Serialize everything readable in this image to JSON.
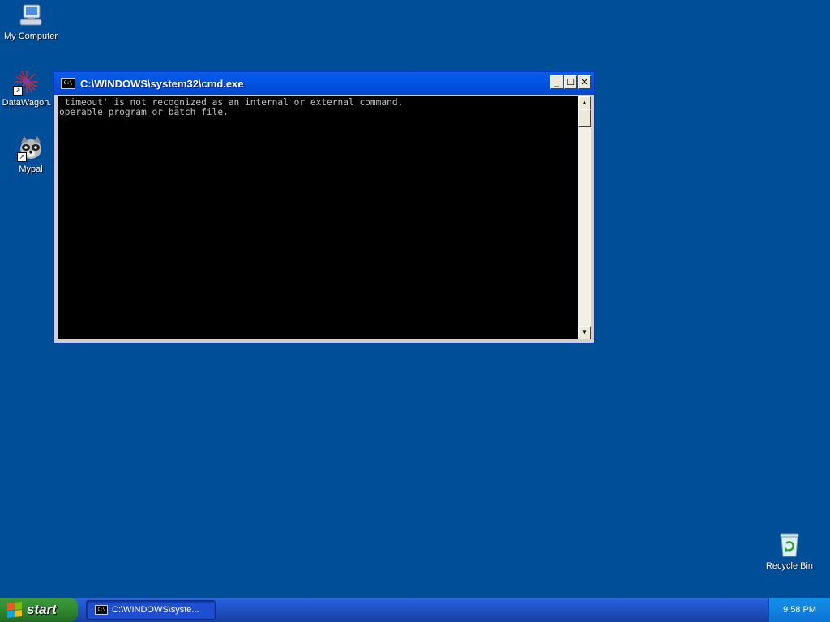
{
  "desktop": {
    "icons": [
      {
        "label": "My Computer",
        "icon": "computer-icon"
      },
      {
        "label": "DataWagon.",
        "icon": "datawagon-icon"
      },
      {
        "label": "Mypal",
        "icon": "mypal-raccoon-icon"
      },
      {
        "label": "Recycle Bin",
        "icon": "recycle-bin-icon"
      }
    ],
    "background_color": "#004e98"
  },
  "window": {
    "title": "C:\\WINDOWS\\system32\\cmd.exe",
    "icon_text": "C:\\",
    "console_lines": [
      "'timeout' is not recognized as an internal or external command,",
      "operable program or batch file."
    ],
    "buttons": {
      "minimize": "_",
      "maximize": "☐",
      "close": "✕"
    }
  },
  "taskbar": {
    "start_label": "start",
    "task_button_label": "C:\\WINDOWS\\syste...",
    "clock": "9:58 PM"
  }
}
